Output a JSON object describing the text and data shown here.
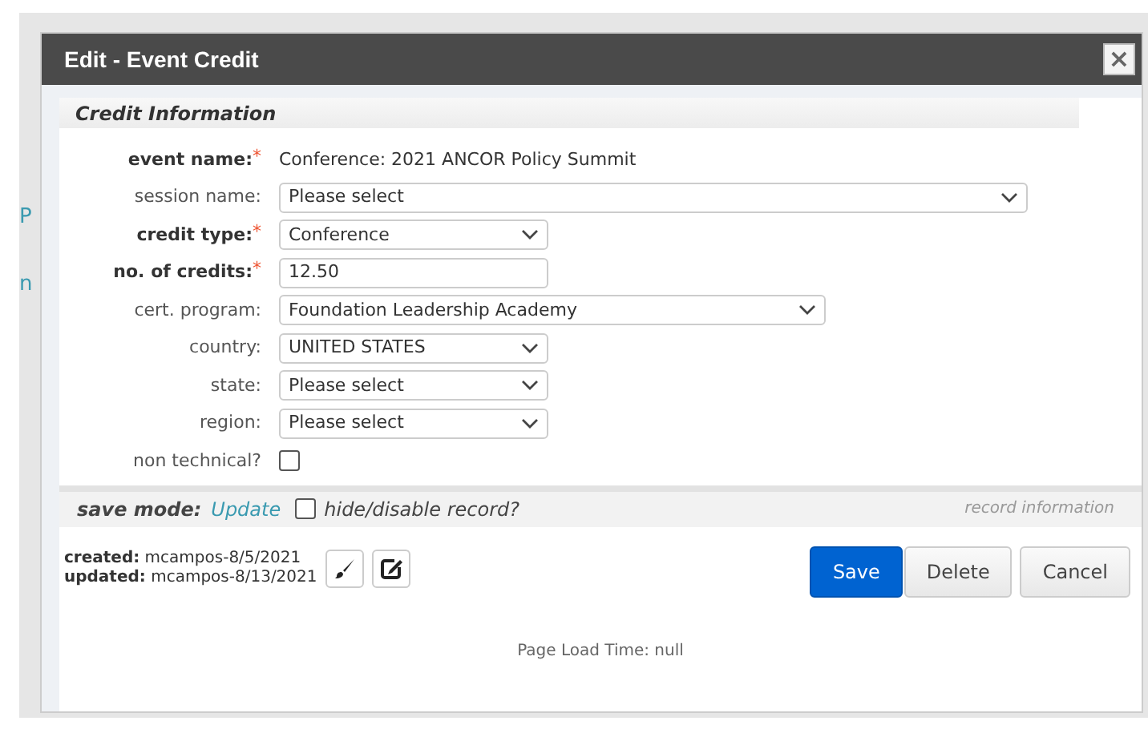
{
  "background": {
    "fragments": [
      "P",
      "n"
    ]
  },
  "dialog": {
    "title": "Edit - Event Credit",
    "close": "×"
  },
  "section": {
    "title": "Credit Information"
  },
  "fields": [
    {
      "label": "event name:",
      "asterisk": "*",
      "kind": "text",
      "value": "Conference: 2021 ANCOR Policy Summit"
    },
    {
      "label": "session name:",
      "kind": "select",
      "value": "Please select"
    },
    {
      "label": "credit type:",
      "asterisk": "*",
      "kind": "select",
      "value": "Conference"
    },
    {
      "label": "no. of credits:",
      "asterisk": "*",
      "kind": "input",
      "value": "12.50"
    },
    {
      "label": "cert. program:",
      "kind": "select",
      "value": "Foundation Leadership Academy"
    },
    {
      "label": "country:",
      "kind": "select",
      "value": "UNITED STATES"
    },
    {
      "label": "state:",
      "kind": "select",
      "value": "Please select"
    },
    {
      "label": "region:",
      "kind": "select",
      "value": "Please select"
    },
    {
      "label": "non technical?",
      "kind": "checkbox",
      "checked": false
    }
  ],
  "save_bar": {
    "label": "save mode:",
    "mode": "Update",
    "hide_label": "hide/disable record?",
    "hide_checked": false,
    "record_info": "record information"
  },
  "audit": [
    {
      "label": "created:",
      "value": "mcampos-8/5/2021"
    },
    {
      "label": "updated:",
      "value": "mcampos-8/13/2021"
    }
  ],
  "buttons": [
    {
      "label": "Save",
      "kind": "primary"
    },
    {
      "label": "Delete",
      "kind": "default"
    },
    {
      "label": "Cancel",
      "kind": "default"
    }
  ],
  "footer": "Page Load Time: null"
}
